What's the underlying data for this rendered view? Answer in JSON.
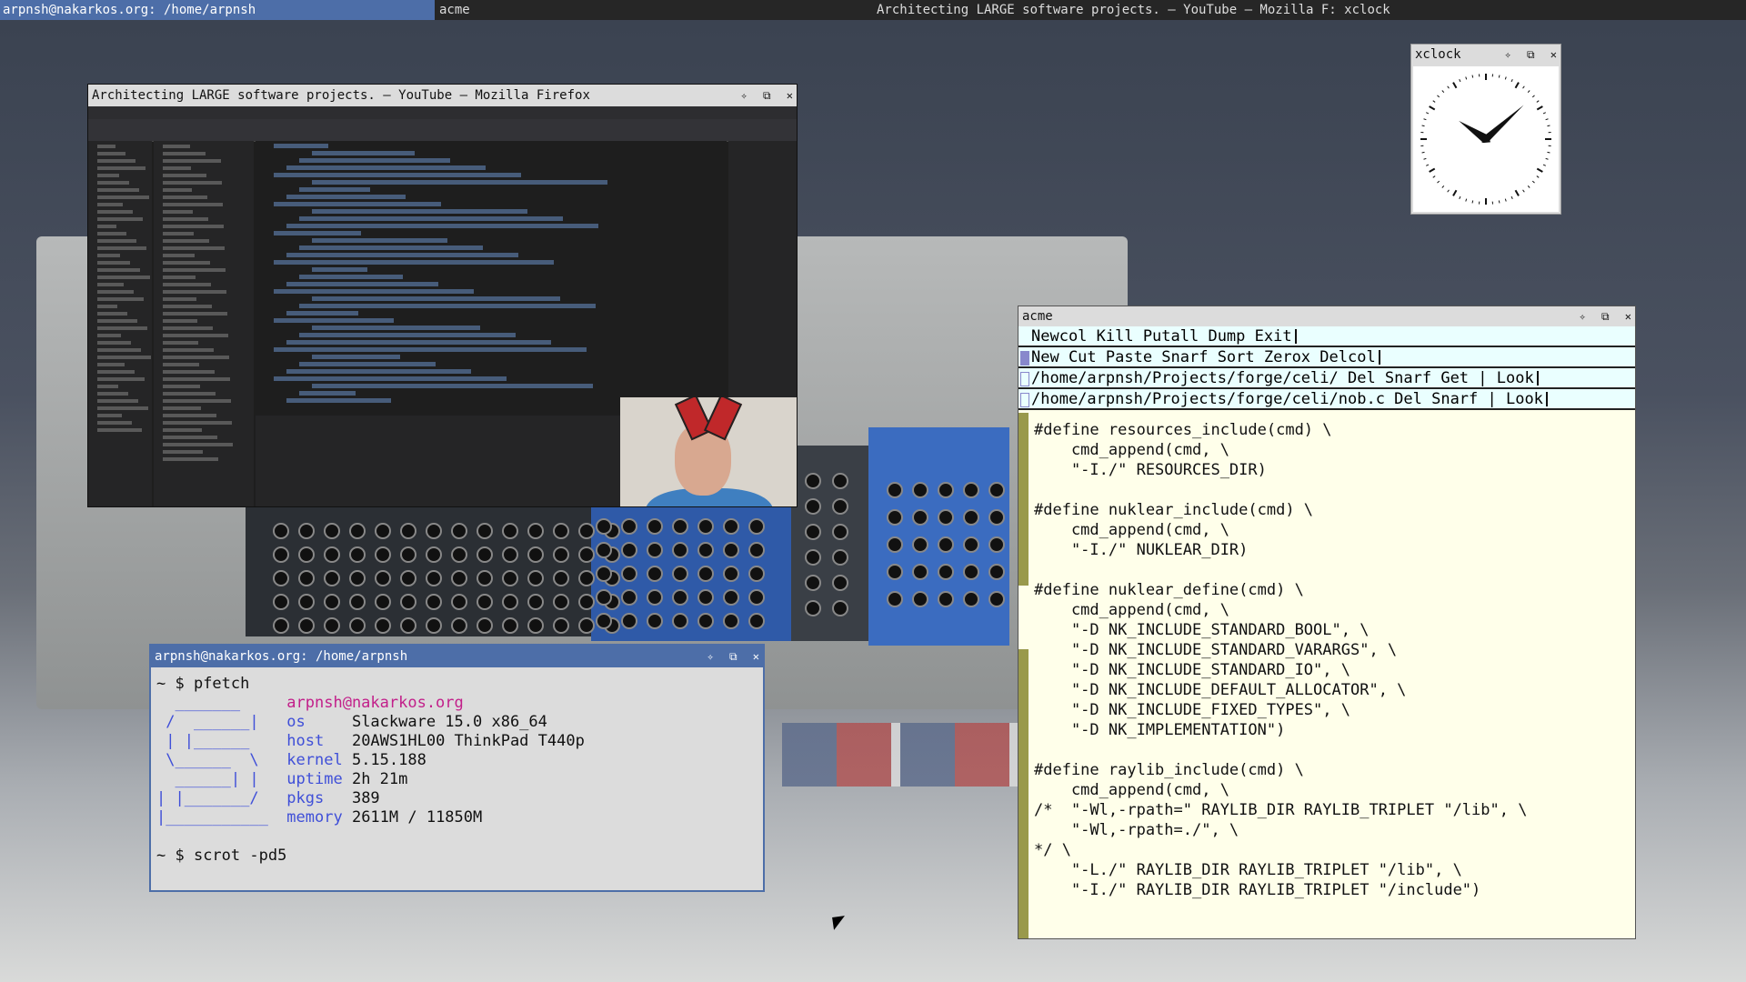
{
  "topbar": {
    "left_label": "arpnsh@nakarkos.org: /home/arpnsh",
    "acme_label": "acme",
    "active_title": "Architecting LARGE software projects. – YouTube – Mozilla F: xclock"
  },
  "window_controls": {
    "sticky": "✧",
    "maximize": "⧉",
    "close": "✕"
  },
  "firefox": {
    "title": "Architecting LARGE software projects. – YouTube – Mozilla Firefox"
  },
  "xclock": {
    "title": "xclock",
    "time": {
      "hour": 10,
      "minute": 8
    }
  },
  "terminal": {
    "title": "arpnsh@nakarkos.org: /home/arpnsh",
    "prompt": "~ $ ",
    "command1": "pfetch",
    "logo": [
      "  _______",
      " /  ______|",
      " | |______",
      " \\______  \\",
      "  ______| |",
      "| |_______/",
      "|___________"
    ],
    "user_host": "arpnsh@nakarkos.org",
    "info": [
      {
        "label": "os",
        "value": "Slackware 15.0 x86_64"
      },
      {
        "label": "host",
        "value": "20AWS1HL00 ThinkPad T440p"
      },
      {
        "label": "kernel",
        "value": "5.15.188"
      },
      {
        "label": "uptime",
        "value": "2h 21m"
      },
      {
        "label": "pkgs",
        "value": "389"
      },
      {
        "label": "memory",
        "value": "2611M / 11850M"
      }
    ],
    "command2": "scrot -pd5"
  },
  "acme": {
    "title": "acme",
    "tags": [
      "Newcol Kill Putall Dump Exit",
      "New Cut Paste Snarf Sort Zerox Delcol",
      "/home/arpnsh/Projects/forge/celi/ Del Snarf Get | Look",
      "/home/arpnsh/Projects/forge/celi/nob.c Del Snarf | Look"
    ],
    "body_lines": [
      "#define resources_include(cmd) \\",
      "    cmd_append(cmd, \\",
      "    \"-I./\" RESOURCES_DIR)",
      "",
      "#define nuklear_include(cmd) \\",
      "    cmd_append(cmd, \\",
      "    \"-I./\" NUKLEAR_DIR)",
      "",
      "#define nuklear_define(cmd) \\",
      "    cmd_append(cmd, \\",
      "    \"-D NK_INCLUDE_STANDARD_BOOL\", \\",
      "    \"-D NK_INCLUDE_STANDARD_VARARGS\", \\",
      "    \"-D NK_INCLUDE_STANDARD_IO\", \\",
      "    \"-D NK_INCLUDE_DEFAULT_ALLOCATOR\", \\",
      "    \"-D NK_INCLUDE_FIXED_TYPES\", \\",
      "    \"-D NK_IMPLEMENTATION\")",
      "",
      "#define raylib_include(cmd) \\",
      "    cmd_append(cmd, \\",
      "/*  \"-Wl,-rpath=\" RAYLIB_DIR RAYLIB_TRIPLET \"/lib\", \\",
      "    \"-Wl,-rpath=./\", \\",
      "*/ \\",
      "    \"-L./\" RAYLIB_DIR RAYLIB_TRIPLET \"/lib\", \\",
      "    \"-I./\" RAYLIB_DIR RAYLIB_TRIPLET \"/include\")"
    ]
  },
  "colors": {
    "accent_blue": "#4d6ea8",
    "acme_body": "#ffffea",
    "acme_tag": "#eaffff",
    "acme_scroll": "#99994c",
    "pfetch_label": "#3f4fd8",
    "pfetch_userhost": "#c21f8a"
  }
}
